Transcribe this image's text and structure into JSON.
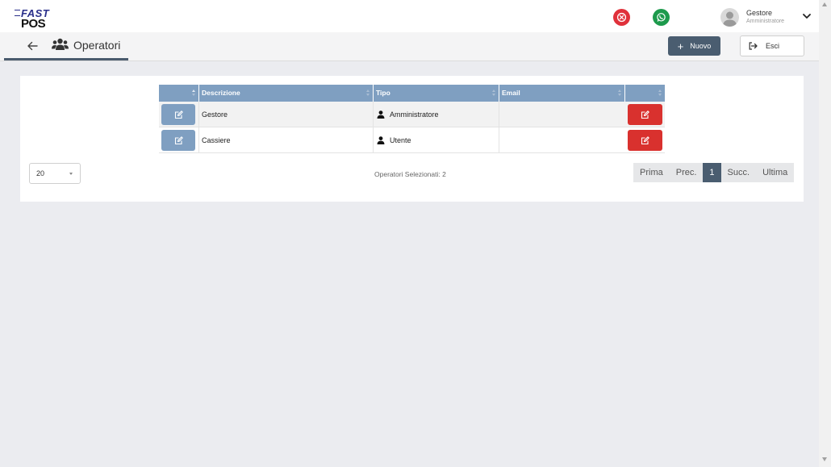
{
  "app": {
    "logo_top": "FAST",
    "logo_bottom": "POS"
  },
  "user": {
    "name": "Gestore",
    "role": "Amministratore"
  },
  "header": {
    "title": "Operatori",
    "new_button": "Nuovo",
    "exit_button": "Esci"
  },
  "table": {
    "columns": [
      "Descrizione",
      "Tipo",
      "Email"
    ],
    "rows": [
      {
        "descrizione": "Gestore",
        "tipo": "Amministratore",
        "email": ""
      },
      {
        "descrizione": "Cassiere",
        "tipo": "Utente",
        "email": ""
      }
    ]
  },
  "footer": {
    "page_size": "20",
    "selected_label": "Operatori Selezionati: 2",
    "pagination": {
      "first": "Prima",
      "prev": "Prec.",
      "current": "1",
      "next": "Succ.",
      "last": "Ultima"
    }
  },
  "colors": {
    "primary": "#4a5d70",
    "table_header": "#7f9fc1",
    "danger": "#d9312e",
    "whatsapp": "#1d9a4c"
  }
}
